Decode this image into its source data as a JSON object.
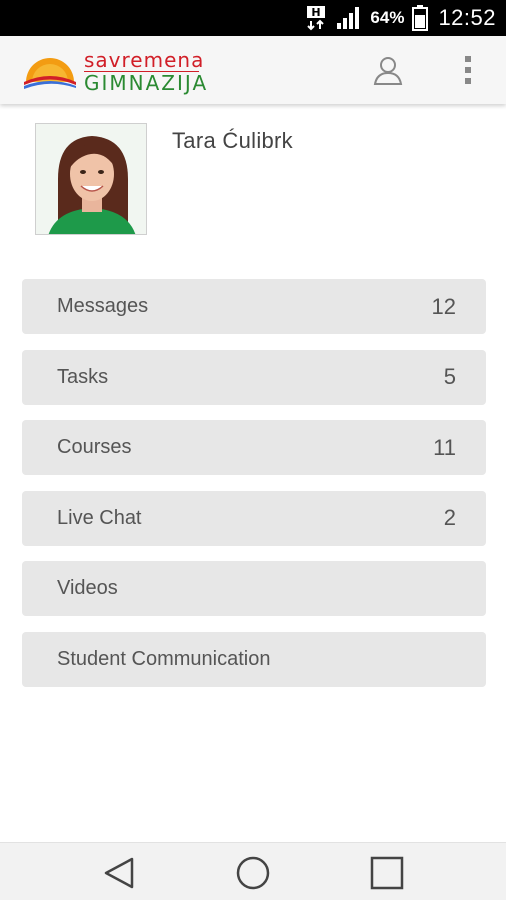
{
  "status_bar": {
    "network_type": "H",
    "battery_percent": "64%",
    "time": "12:52"
  },
  "header": {
    "logo_line1": "savremena",
    "logo_line2": "GIMNAZIJA",
    "colors": {
      "logo_red": "#d11f28",
      "logo_green": "#2b8a32",
      "logo_orange": "#f39c12"
    }
  },
  "profile": {
    "name": "Tara Ćulibrk"
  },
  "menu": {
    "items": [
      {
        "label": "Messages",
        "count": "12"
      },
      {
        "label": "Tasks",
        "count": "5"
      },
      {
        "label": "Courses",
        "count": "11"
      },
      {
        "label": "Live Chat",
        "count": "2"
      },
      {
        "label": "Videos",
        "count": ""
      },
      {
        "label": "Student Communication",
        "count": ""
      }
    ]
  },
  "icons": {
    "header": [
      "user-icon",
      "more-vert-icon"
    ],
    "nav": [
      "back-icon",
      "home-icon",
      "recents-icon"
    ]
  }
}
